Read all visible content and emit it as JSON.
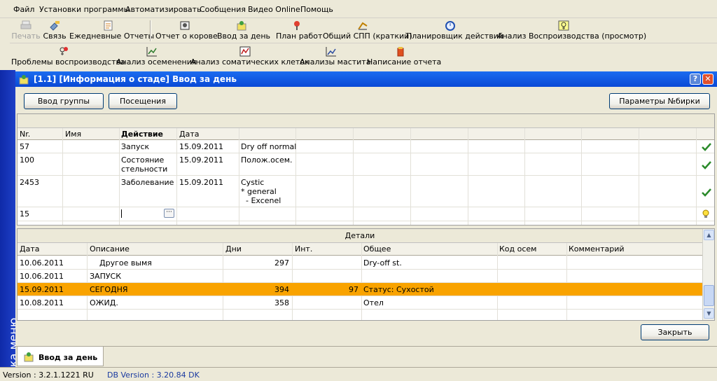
{
  "menu": [
    "Файл",
    "Установки программы",
    "Автоматизировать",
    "Сообщения",
    "Видео Online",
    "Помощь"
  ],
  "toolbar1": [
    {
      "label": "Печать",
      "icon": "printer-icon",
      "disabled": true
    },
    {
      "label": "Связь",
      "icon": "link-icon"
    },
    {
      "label": "Ежедневные Отчеты",
      "icon": "daily-report-icon"
    },
    {
      "label": "Отчет о корове",
      "icon": "cow-report-icon"
    },
    {
      "label": "Ввод за день",
      "icon": "daily-input-icon"
    },
    {
      "label": "План работ",
      "icon": "work-plan-icon"
    },
    {
      "label": "Общий СПП (краткий)",
      "icon": "summary-icon"
    },
    {
      "label": "Планировщик действий",
      "icon": "stopwatch-icon"
    },
    {
      "label": "Анализ Воспроизводства (просмотр)",
      "icon": "reproduction-icon"
    }
  ],
  "toolbar2": [
    {
      "label": "Проблемы воспроизводства",
      "icon": "reproduction-problem-icon"
    },
    {
      "label": "Анализ осеменения",
      "icon": "insemination-chart-icon"
    },
    {
      "label": "Анализ соматических клеток",
      "icon": "somatic-chart-icon"
    },
    {
      "label": "Анализы мастита",
      "icon": "mastitis-chart-icon"
    },
    {
      "label": "Написание отчета",
      "icon": "report-writing-icon"
    }
  ],
  "sidebar_label": "Строка меню",
  "window": {
    "title": "[1.1] [Информация о стаде] Ввод за день",
    "btn_group": "Ввод группы",
    "btn_visits": "Посещения",
    "btn_params": "Параметры №бирки",
    "btn_close": "Закрыть"
  },
  "grid1": {
    "columns": [
      "Nr.",
      "Имя",
      "Действие",
      "Дата"
    ],
    "rows": [
      {
        "nr": "57",
        "name": "",
        "action": "Запуск",
        "date": "15.09.2011",
        "general": "Dry off normal",
        "status": "ok"
      },
      {
        "nr": "100",
        "name": "",
        "action": "Состояние\nстельности",
        "date": "15.09.2011",
        "general": "Полож.осем.",
        "status": "ok"
      },
      {
        "nr": "2453",
        "name": "",
        "action": "Заболевание",
        "date": "15.09.2011",
        "general": "Cystic\n* general\n  - Excenel",
        "status": "ok"
      },
      {
        "nr": "15",
        "name": "",
        "action": "",
        "date": "",
        "general": "",
        "status": "edit"
      }
    ],
    "ellipsis": "···"
  },
  "grid2": {
    "title": "Детали",
    "columns": [
      "Дата",
      "Описание",
      "Дни",
      "Инт.",
      "Общее",
      "Код осем",
      "Комментарий"
    ],
    "rows": [
      {
        "date": "10.06.2011",
        "desc": "    Другое вымя",
        "days": "297",
        "int": "",
        "general": "Dry-off st.",
        "code": "",
        "comment": "",
        "highlight": false
      },
      {
        "date": "10.06.2011",
        "desc": "ЗАПУСК",
        "days": "",
        "int": "",
        "general": "",
        "code": "",
        "comment": "",
        "highlight": false
      },
      {
        "date": "15.09.2011",
        "desc": "СЕГОДНЯ",
        "days": "394",
        "int": "97",
        "general": "Статус: Сухостой",
        "code": "",
        "comment": "",
        "highlight": true
      },
      {
        "date": "10.08.2011",
        "desc": "ОЖИД.",
        "days": "358",
        "int": "",
        "general": "Отел",
        "code": "",
        "comment": "",
        "highlight": false
      }
    ]
  },
  "tab": "Ввод за день",
  "status": {
    "version": "Version : 3.2.1.1221 RU",
    "db_version": "DB Version : 3.20.84 DK"
  },
  "colors": {
    "highlight": "#f9a300",
    "titlebar": "#0a49d6",
    "sidebar": "#1d3fc7"
  }
}
